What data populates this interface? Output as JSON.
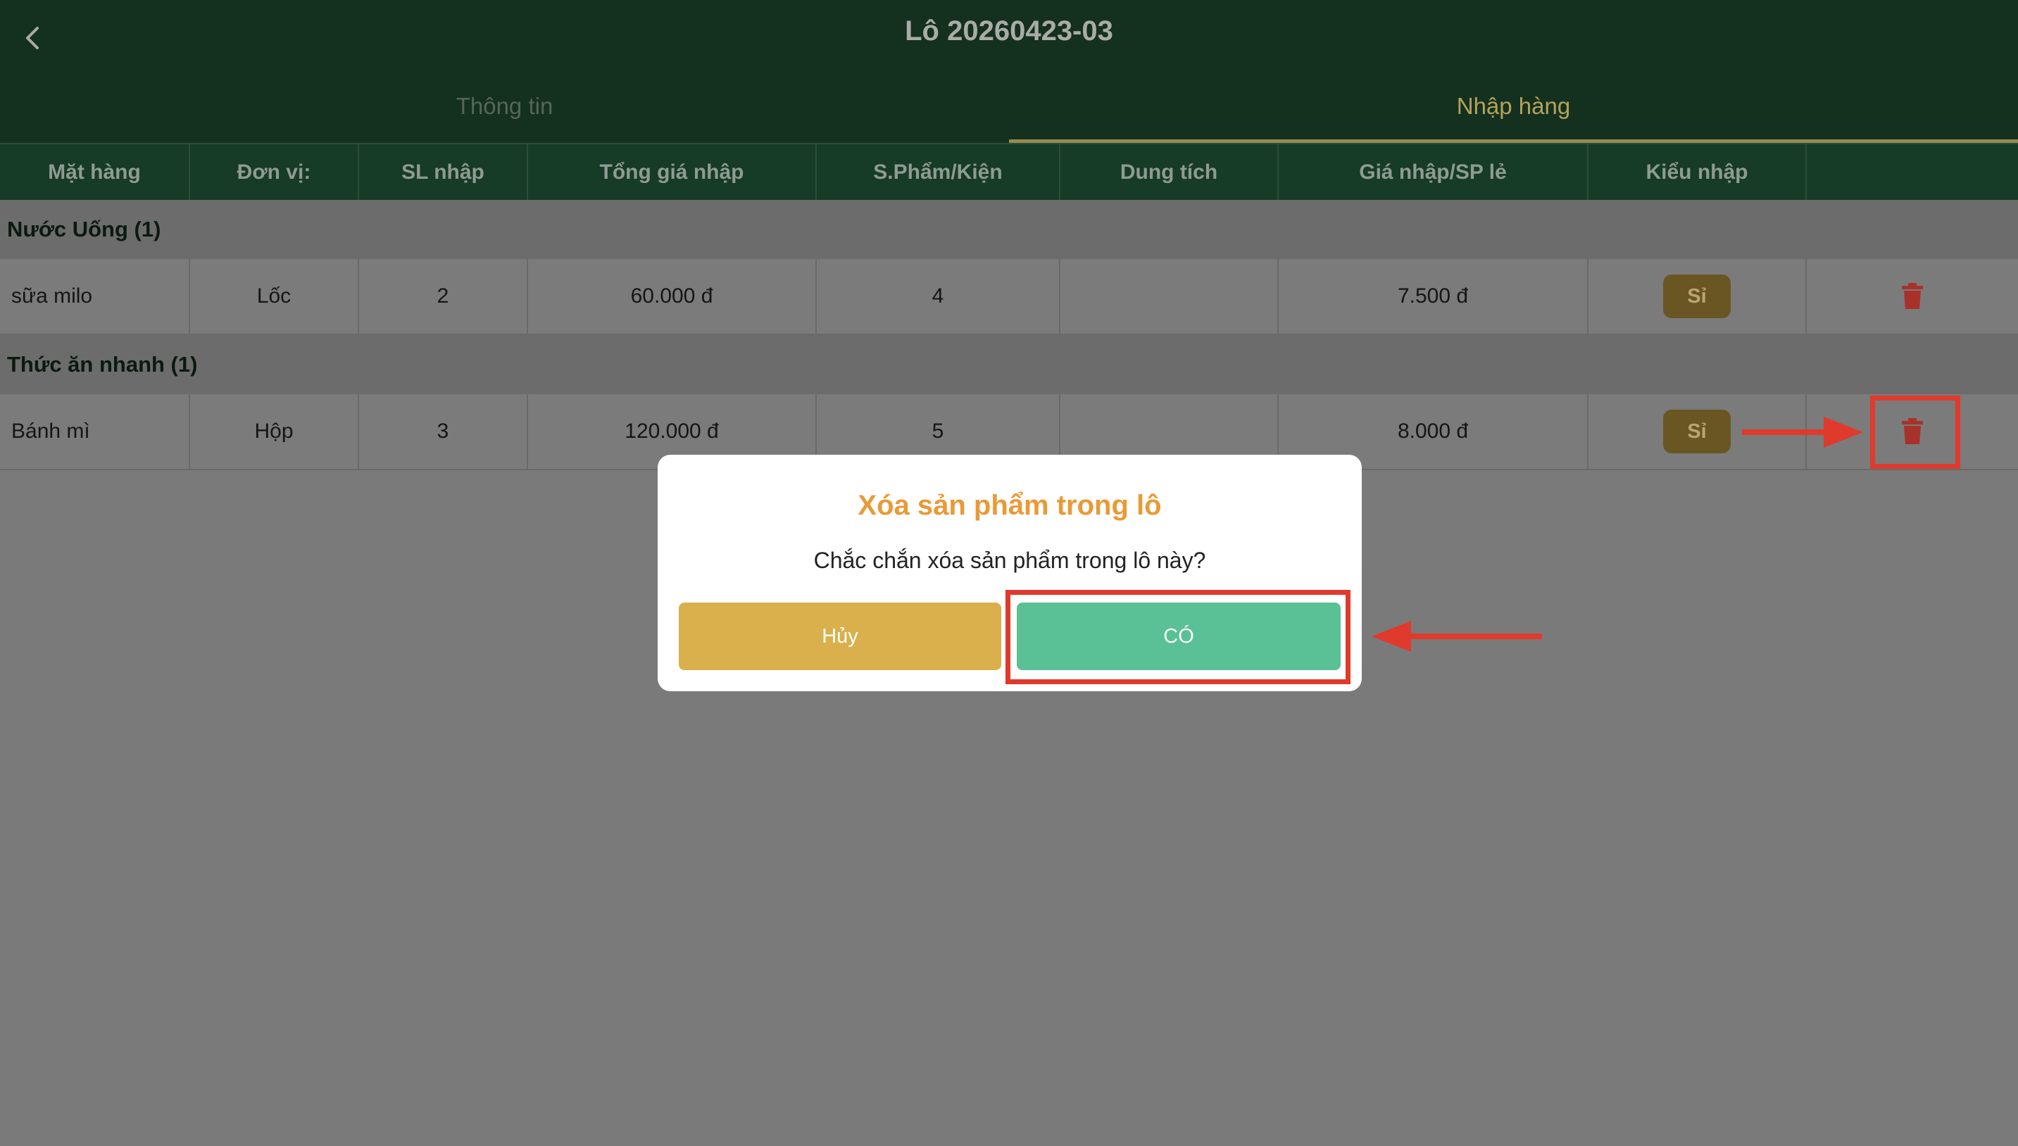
{
  "header": {
    "title": "Lô 20260423-03",
    "back_icon": "chevron-left-icon"
  },
  "tabs": [
    {
      "label": "Thông tin",
      "active": false
    },
    {
      "label": "Nhập hàng",
      "active": true
    }
  ],
  "table": {
    "columns": [
      "Mặt hàng",
      "Đơn vị:",
      "SL nhập",
      "Tổng giá nhập",
      "S.Phẩm/Kiện",
      "Dung tích",
      "Giá nhập/SP lẻ",
      "Kiểu nhập",
      ""
    ],
    "groups": [
      {
        "name": "Nước Uống (1)",
        "rows": [
          {
            "item": "sữa milo",
            "unit": "Lốc",
            "qty": "2",
            "total": "60.000 đ",
            "per_pack": "4",
            "volume": "",
            "unit_price": "7.500 đ",
            "type": "Sỉ"
          }
        ]
      },
      {
        "name": "Thức ăn nhanh (1)",
        "rows": [
          {
            "item": "Bánh mì",
            "unit": "Hộp",
            "qty": "3",
            "total": "120.000 đ",
            "per_pack": "5",
            "volume": "",
            "unit_price": "8.000 đ",
            "type": "Sỉ"
          }
        ]
      }
    ],
    "delete_icon": "trash-icon"
  },
  "dialog": {
    "title": "Xóa sản phẩm trong lô",
    "message": "Chắc chắn xóa sản phẩm trong lô này?",
    "cancel_label": "Hủy",
    "confirm_label": "CÓ"
  },
  "colors": {
    "header_bg": "#14301f",
    "accent_gold": "#d9b04b",
    "confirm_green": "#59c195",
    "title_orange": "#e99a37",
    "annotation_red": "#e03a2c",
    "delete_red": "#a8322a"
  }
}
